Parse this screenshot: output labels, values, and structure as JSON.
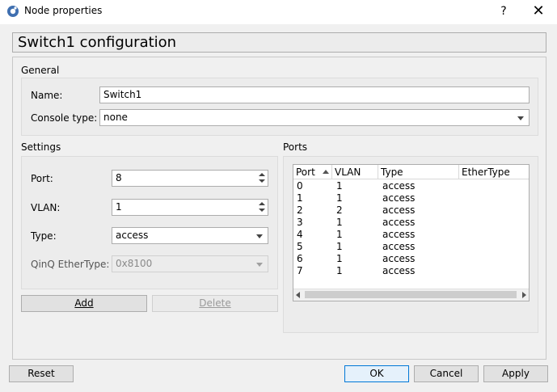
{
  "window": {
    "title": "Node properties",
    "help": "?",
    "close": "✕"
  },
  "header": {
    "title": "Switch1 configuration"
  },
  "general": {
    "title": "General",
    "name_label": "Name:",
    "name_value": "Switch1",
    "console_label": "Console type:",
    "console_value": "none"
  },
  "settings": {
    "title": "Settings",
    "port_label": "Port:",
    "port_value": "8",
    "vlan_label": "VLAN:",
    "vlan_value": "1",
    "type_label": "Type:",
    "type_value": "access",
    "qinq_label": "QinQ EtherType:",
    "qinq_value": "0x8100"
  },
  "ports": {
    "title": "Ports",
    "columns": [
      "Port",
      "VLAN",
      "Type",
      "EtherType"
    ],
    "rows": [
      [
        "0",
        "1",
        "access",
        ""
      ],
      [
        "1",
        "1",
        "access",
        ""
      ],
      [
        "2",
        "2",
        "access",
        ""
      ],
      [
        "3",
        "1",
        "access",
        ""
      ],
      [
        "4",
        "1",
        "access",
        ""
      ],
      [
        "5",
        "1",
        "access",
        ""
      ],
      [
        "6",
        "1",
        "access",
        ""
      ],
      [
        "7",
        "1",
        "access",
        ""
      ]
    ]
  },
  "buttons": {
    "add": "Add",
    "delete": "Delete",
    "reset": "Reset",
    "ok": "OK",
    "cancel": "Cancel",
    "apply": "Apply"
  }
}
